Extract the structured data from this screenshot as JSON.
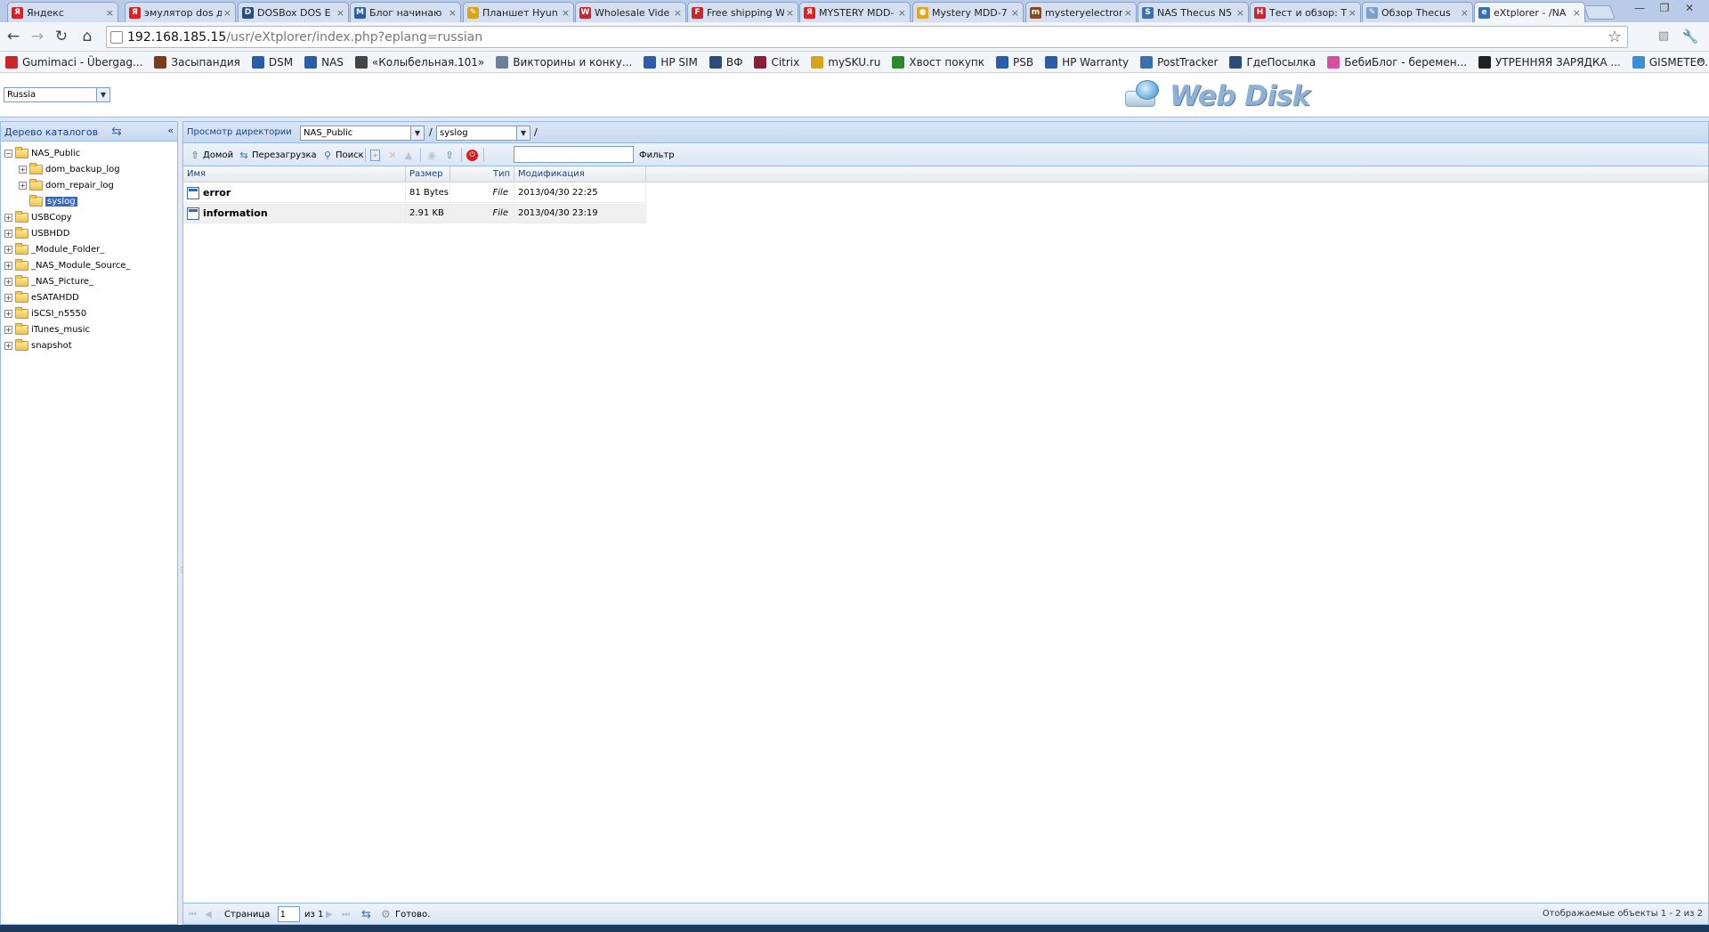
{
  "browser": {
    "tabs": [
      {
        "title": "Яндекс",
        "fav": "Я",
        "color": "#e02020"
      },
      {
        "title": "эмулятор dos д",
        "fav": "Я",
        "color": "#e02020"
      },
      {
        "title": "DOSBox DOS E",
        "fav": "D",
        "color": "#2b4d7a"
      },
      {
        "title": "Блог начинаю",
        "fav": "M",
        "color": "#2b5ca8"
      },
      {
        "title": "Планшет Hyun",
        "fav": "✎",
        "color": "#d9a21b"
      },
      {
        "title": "Wholesale Vide",
        "fav": "W",
        "color": "#c8262b"
      },
      {
        "title": "Free shipping W",
        "fav": "F",
        "color": "#c8262b"
      },
      {
        "title": "MYSTERY MDD-",
        "fav": "Я",
        "color": "#e02020"
      },
      {
        "title": "Mystery MDD-7",
        "fav": "●",
        "color": "#e8a317"
      },
      {
        "title": "mysteryelectron",
        "fav": "m",
        "color": "#8a4b1f"
      },
      {
        "title": "NAS Thecus N5",
        "fav": "S",
        "color": "#3a6fb0"
      },
      {
        "title": "Тест и обзор: T",
        "fav": "H",
        "color": "#c8262b"
      },
      {
        "title": "Обзор Thecus",
        "fav": "✎",
        "color": "#7aa0c9"
      },
      {
        "title": "eXtplorer - /NA",
        "fav": "e",
        "color": "#3a6fb0"
      }
    ],
    "address": {
      "host": "192.168.185.15",
      "path": "/usr/eXtplorer/index.php?eplang=russian"
    },
    "bookmarks": [
      {
        "label": "Gumimaci - Übergag...",
        "color": "#c8262b"
      },
      {
        "label": "Засыпандия",
        "color": "#7a3b1a"
      },
      {
        "label": "DSM",
        "color": "#2b5ca8"
      },
      {
        "label": "NAS",
        "color": "#2b5ca8"
      },
      {
        "label": "«Колыбельная.101»",
        "color": "#444444"
      },
      {
        "label": "Викторины и конку...",
        "color": "#6a7f99"
      },
      {
        "label": "HP SIM",
        "color": "#2b5ca8"
      },
      {
        "label": "ВФ",
        "color": "#2b4d7a"
      },
      {
        "label": "Citrix",
        "color": "#8a1f3a"
      },
      {
        "label": "mySKU.ru",
        "color": "#d9a21b"
      },
      {
        "label": "Хвост покупк",
        "color": "#2a8a2a"
      },
      {
        "label": "PSB",
        "color": "#2b5ca8"
      },
      {
        "label": "HP Warranty",
        "color": "#2b5ca8"
      },
      {
        "label": "PostTracker",
        "color": "#3a6fb0"
      },
      {
        "label": "ГдеПосылка",
        "color": "#2b4d7a"
      },
      {
        "label": "БебиБлог - беремен...",
        "color": "#d64fa0"
      },
      {
        "label": "УТРЕННЯЯ ЗАРЯДКА ...",
        "color": "#222222"
      },
      {
        "label": "GISMETEO.RU: Пого...",
        "color": "#3a8fd0"
      }
    ]
  },
  "header": {
    "language": "Russia",
    "logo_text": "Web Disk"
  },
  "tree": {
    "title": "Дерево каталогов",
    "nodes": [
      {
        "label": "NAS_Public",
        "level": 0,
        "expander": "−",
        "selected": false
      },
      {
        "label": "dom_backup_log",
        "level": 1,
        "expander": "+",
        "selected": false
      },
      {
        "label": "dom_repair_log",
        "level": 1,
        "expander": "+",
        "selected": false
      },
      {
        "label": "syslog",
        "level": 1,
        "expander": "",
        "selected": true
      },
      {
        "label": "USBCopy",
        "level": 0,
        "expander": "+",
        "selected": false
      },
      {
        "label": "USBHDD",
        "level": 0,
        "expander": "+",
        "selected": false
      },
      {
        "label": "_Module_Folder_",
        "level": 0,
        "expander": "+",
        "selected": false
      },
      {
        "label": "_NAS_Module_Source_",
        "level": 0,
        "expander": "+",
        "selected": false
      },
      {
        "label": "_NAS_Picture_",
        "level": 0,
        "expander": "+",
        "selected": false
      },
      {
        "label": "eSATAHDD",
        "level": 0,
        "expander": "+",
        "selected": false
      },
      {
        "label": "iSCSI_n5550",
        "level": 0,
        "expander": "+",
        "selected": false
      },
      {
        "label": "iTunes_music",
        "level": 0,
        "expander": "+",
        "selected": false
      },
      {
        "label": "snapshot",
        "level": 0,
        "expander": "+",
        "selected": false
      }
    ]
  },
  "dirbar": {
    "label": "Просмотр директории",
    "combo1": "NAS_Public",
    "combo2": "syslog",
    "slash": "/"
  },
  "actions": {
    "home": "Домой",
    "reload": "Перезагрузка",
    "search": "Поиск",
    "filter": "Фильтр",
    "filter_value": ""
  },
  "grid": {
    "columns": [
      "Имя",
      "Размер",
      "Тип",
      "Модификация"
    ],
    "rows": [
      {
        "name": "error",
        "size": "81 Bytes",
        "type": "File",
        "modified": "2013/04/30 22:25"
      },
      {
        "name": "information",
        "size": "2.91 KB",
        "type": "File",
        "modified": "2013/04/30 23:19"
      }
    ]
  },
  "pager": {
    "page_label": "Страница",
    "page_value": "1",
    "of_label": "из 1",
    "status": "Готово.",
    "right_text": "Отображаемые объекты 1 - 2 из 2"
  }
}
